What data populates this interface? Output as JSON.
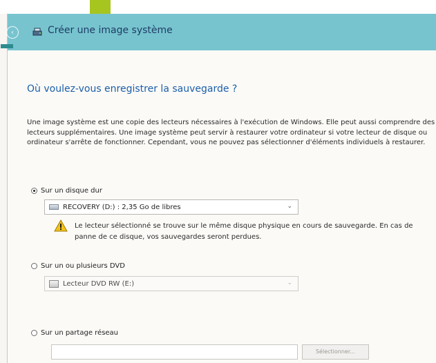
{
  "window": {
    "title": "Créer une image système",
    "icons": {
      "back": "back-arrow-icon",
      "app": "system-image-icon"
    },
    "colors": {
      "titlebar": "#77c4cf",
      "heading": "#1b5ea8",
      "accent_green": "#a6c51f"
    }
  },
  "main": {
    "heading": "Où voulez-vous enregistrer la sauvegarde ?",
    "description": "Une image système est une copie des lecteurs nécessaires à l'exécution de Windows. Elle peut aussi comprendre des lecteurs supplémentaires. Une image système peut servir à restaurer votre ordinateur si votre lecteur de disque ou ordinateur s'arrête de fonctionner. Cependant, vous ne pouvez pas sélectionner d'éléments individuels à restaurer.",
    "options": {
      "hard_disk": {
        "label": "Sur un disque dur",
        "selected": true,
        "select_value": "RECOVERY (D:) : 2,35 Go de libres",
        "warning": "Le lecteur sélectionné se trouve sur le même disque physique en cours de sauvegarde. En cas de panne de ce disque, vos sauvegardes seront perdues."
      },
      "dvd": {
        "label": "Sur un ou plusieurs DVD",
        "selected": false,
        "select_value": "Lecteur DVD RW (E:)"
      },
      "network": {
        "label": "Sur un partage réseau",
        "selected": false,
        "input_value": "",
        "browse_label": "Sélectionner..."
      }
    }
  }
}
